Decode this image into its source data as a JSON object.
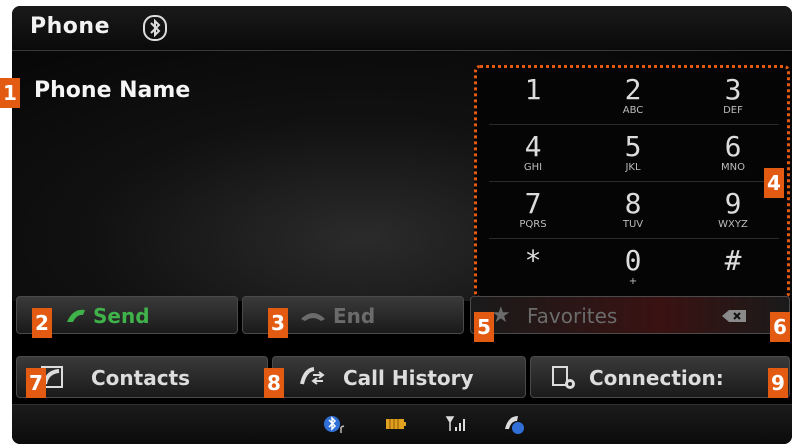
{
  "header": {
    "title": "Phone",
    "bluetooth_icon": "bluetooth-icon"
  },
  "phone_name": "Phone Name",
  "keypad": {
    "keys": [
      {
        "digit": "1",
        "letters": ""
      },
      {
        "digit": "2",
        "letters": "ABC"
      },
      {
        "digit": "3",
        "letters": "DEF"
      },
      {
        "digit": "4",
        "letters": "GHI"
      },
      {
        "digit": "5",
        "letters": "JKL"
      },
      {
        "digit": "6",
        "letters": "MNO"
      },
      {
        "digit": "7",
        "letters": "PQRS"
      },
      {
        "digit": "8",
        "letters": "TUV"
      },
      {
        "digit": "9",
        "letters": "WXYZ"
      },
      {
        "digit": "*",
        "letters": ""
      },
      {
        "digit": "0",
        "letters": "+"
      },
      {
        "digit": "#",
        "letters": ""
      }
    ]
  },
  "actions": {
    "send_label": "Send",
    "end_label": "End",
    "favorites_label": "Favorites"
  },
  "nav": {
    "contacts_label": "Contacts",
    "call_history_label": "Call History",
    "connections_label": "Connection:"
  },
  "callouts": [
    "1",
    "2",
    "3",
    "4",
    "5",
    "6",
    "7",
    "8",
    "9"
  ],
  "colors": {
    "accent_orange": "#e35a12",
    "send_green": "#3fb24a",
    "disabled_gray": "#6b6b6b"
  }
}
